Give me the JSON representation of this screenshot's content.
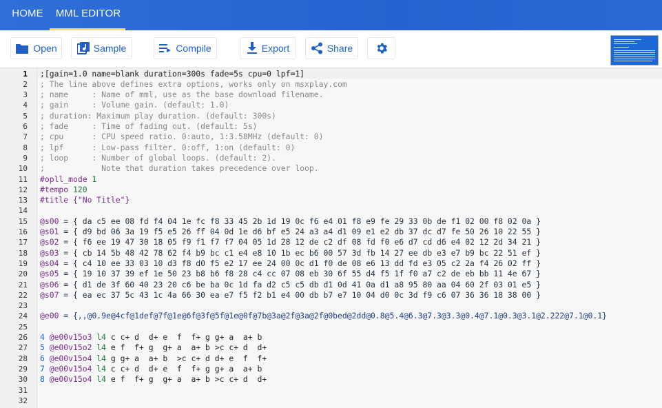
{
  "tabs": [
    {
      "label": "HOME"
    },
    {
      "label": "MML EDITOR"
    }
  ],
  "colors": {
    "appbar": "#2563d0",
    "tab_indicator": "#f5e05a",
    "button_text": "#1e5fc8"
  },
  "toolbar": {
    "open": "Open",
    "sample": "Sample",
    "compile": "Compile",
    "export": "Export",
    "share": "Share",
    "settings_icon": "gear-icon"
  },
  "editor": {
    "lines": [
      {
        "n": "1",
        "kind": "header",
        "text": ";[gain=1.0 name=blank duration=300s fade=5s cpu=0 lpf=1]"
      },
      {
        "n": "2",
        "kind": "comment",
        "text": "; The line above defines extra options, works only on msxplay.com"
      },
      {
        "n": "3",
        "kind": "comment",
        "text": "; name     : Name of mml, use as the base download filename."
      },
      {
        "n": "4",
        "kind": "comment",
        "text": "; gain     : Volume gain. (default: 1.0)"
      },
      {
        "n": "5",
        "kind": "comment",
        "text": "; duration: Maximum play duration. (default: 300s)"
      },
      {
        "n": "6",
        "kind": "comment",
        "text": "; fade     : Time of fading out. (default: 5s)"
      },
      {
        "n": "7",
        "kind": "comment",
        "text": "; cpu      : CPU speed ratio. 0:auto, 1:3.58MHz (default: 0)"
      },
      {
        "n": "8",
        "kind": "comment",
        "text": "; lpf      : Low-pass filter. 0:off, 1:on (default: 0)"
      },
      {
        "n": "9",
        "kind": "comment",
        "text": "; loop     : Number of global loops. (default: 2)."
      },
      {
        "n": "10",
        "kind": "comment",
        "text": ";            Note that duration takes precedence over loop."
      },
      {
        "n": "11",
        "kind": "meta",
        "key": "#opll_mode",
        "val": "1"
      },
      {
        "n": "12",
        "kind": "meta",
        "key": "#tempo",
        "val": "120"
      },
      {
        "n": "13",
        "kind": "meta",
        "key": "#title",
        "val": "{\"No Title\"}"
      },
      {
        "n": "14",
        "kind": "blank",
        "text": ""
      },
      {
        "n": "15",
        "kind": "voice",
        "key": "@s00",
        "text": " = { da c5 ee 08 fd f4 04 1e fc f8 33 45 2b 1d 19 0c f6 e4 01 f8 e9 fe 29 33 0b de f1 02 00 f8 02 0a }"
      },
      {
        "n": "16",
        "kind": "voice",
        "key": "@s01",
        "text": " = { d9 bd 06 3a 19 f5 e5 26 ff 04 0d 1e d6 bf e5 24 a3 a4 d1 09 e1 e2 db 37 dc d7 fe 50 26 10 22 55 }"
      },
      {
        "n": "17",
        "kind": "voice",
        "key": "@s02",
        "text": " = { f6 ee 19 47 30 18 05 f9 f1 f7 f7 04 05 1d 28 12 de c2 df 08 fd f0 e6 d7 cd d6 e4 02 12 2d 34 21 }"
      },
      {
        "n": "18",
        "kind": "voice",
        "key": "@s03",
        "text": " = { cb 14 5b 48 42 78 62 f4 b9 bc c1 e4 e8 10 1b ec b6 00 57 3d fb 14 27 ee db e3 e7 b9 bc 22 51 ef }"
      },
      {
        "n": "19",
        "kind": "voice",
        "key": "@s04",
        "text": " = { c4 10 ee 33 03 10 d3 f8 d0 f5 e2 17 ee 24 00 0c d1 f0 de 08 e6 13 dd fd e3 05 c2 2a f4 26 02 ff }"
      },
      {
        "n": "20",
        "kind": "voice",
        "key": "@s05",
        "text": " = { 19 10 37 39 ef 1e 50 23 b8 b6 f8 28 c4 cc 07 08 eb 30 6f 55 d4 f5 1f f0 a7 c2 de eb bb 11 4e 67 }"
      },
      {
        "n": "21",
        "kind": "voice",
        "key": "@s06",
        "text": " = { d1 de 3f 60 40 23 20 c6 be ba 0c 1d fa d2 c5 c5 db d1 0d 41 0a d1 a8 95 80 aa 04 60 2f 03 01 e5 }"
      },
      {
        "n": "22",
        "kind": "voice",
        "key": "@s07",
        "text": " = { ea ec 37 5c 43 1c 4a 66 30 ea e7 f5 f2 b1 e4 00 db b7 e7 10 04 d0 0c 3d f9 c6 07 36 36 18 38 00 }"
      },
      {
        "n": "23",
        "kind": "blank",
        "text": ""
      },
      {
        "n": "24",
        "kind": "macro",
        "key": "@e00",
        "text": " = {,,@0.9e@4cf@1def@7f@1e@6f@3f@5f@1e@0f@7b@3a@2f@3a@2f@0bed@2dd@0.8@5.4@6.3@7.3@3.3@0.4@7.1@0.3@3.1@2.222@7.1@0.1}"
      },
      {
        "n": "25",
        "kind": "blank",
        "text": ""
      },
      {
        "n": "26",
        "kind": "seq",
        "num": "4",
        "mac": "@e00v15o3",
        "len": "l4",
        "notes": "c c+ d  d+ e  f  f+ g g+ a  a+ b"
      },
      {
        "n": "27",
        "kind": "seq",
        "num": "5",
        "mac": "@e00v15o2",
        "len": "l4",
        "notes": "e f  f+ g  g+ a  a+ b >c c+ d  d+"
      },
      {
        "n": "28",
        "kind": "seq",
        "num": "6",
        "mac": "@e00v15o4",
        "len": "l4",
        "notes": "g g+ a  a+ b  >c c+ d d+ e  f  f+"
      },
      {
        "n": "29",
        "kind": "seq",
        "num": "7",
        "mac": "@e00v15o4",
        "len": "l4",
        "notes": "c c+ d  d+ e  f  f+ g g+ a  a+ b"
      },
      {
        "n": "30",
        "kind": "seq",
        "num": "8",
        "mac": "@e00v15o4",
        "len": "l4",
        "notes": "e f  f+ g  g+ a  a+ b >c c+ d  d+"
      },
      {
        "n": "31",
        "kind": "blank",
        "text": ""
      },
      {
        "n": "32",
        "kind": "blank",
        "text": ""
      }
    ]
  }
}
